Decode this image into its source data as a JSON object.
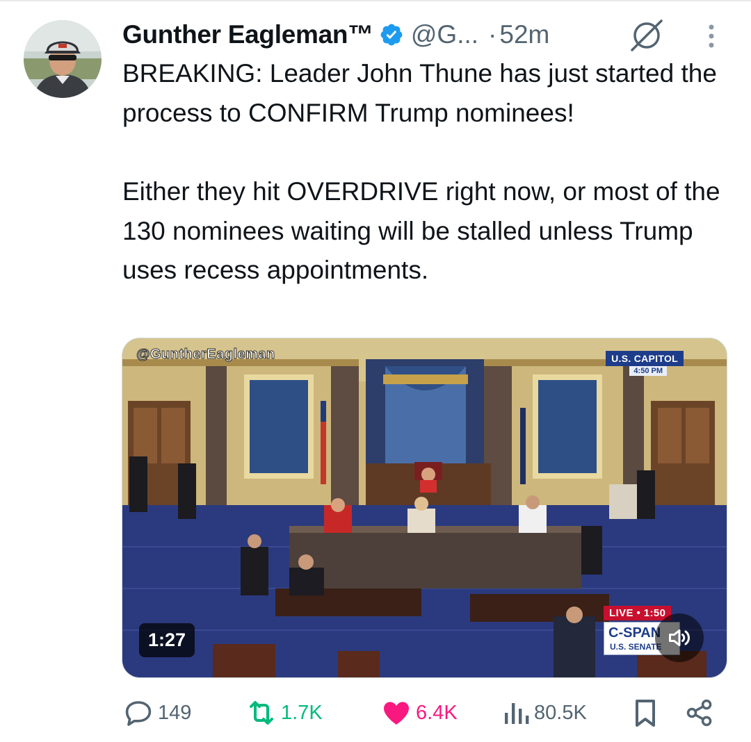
{
  "author": {
    "name": "Gunther Eagleman™",
    "handle": "@G...",
    "time": "52m",
    "separator": "·"
  },
  "tweet": {
    "paragraph1": "BREAKING: Leader John Thune has just started the process to CONFIRM Trump nominees!",
    "paragraph2": "Either they hit OVERDRIVE right now, or most of the 130 nominees waiting will be stalled unless Trump uses recess appointments."
  },
  "media": {
    "watermark": "@GuntherEagleman",
    "location_badge": "U.S. CAPITOL",
    "location_time": "4:50 PM",
    "duration": "1:27",
    "live_label": "LIVE • 1:50",
    "network_logo": "C-SPAN",
    "network_sub": "U.S. SENATE"
  },
  "actions": {
    "replies": "149",
    "reposts": "1.7K",
    "likes": "6.4K",
    "views": "80.5K"
  },
  "colors": {
    "text": "#0f1419",
    "secondary": "#536471",
    "verified": "#1d9bf0",
    "repost_active": "#00ba7c",
    "like_active": "#f91880"
  },
  "icons": [
    "verified-badge-icon",
    "muted-icon",
    "more-icon",
    "reply-icon",
    "retweet-icon",
    "heart-icon",
    "views-icon",
    "bookmark-icon",
    "share-icon",
    "volume-muted-icon"
  ]
}
